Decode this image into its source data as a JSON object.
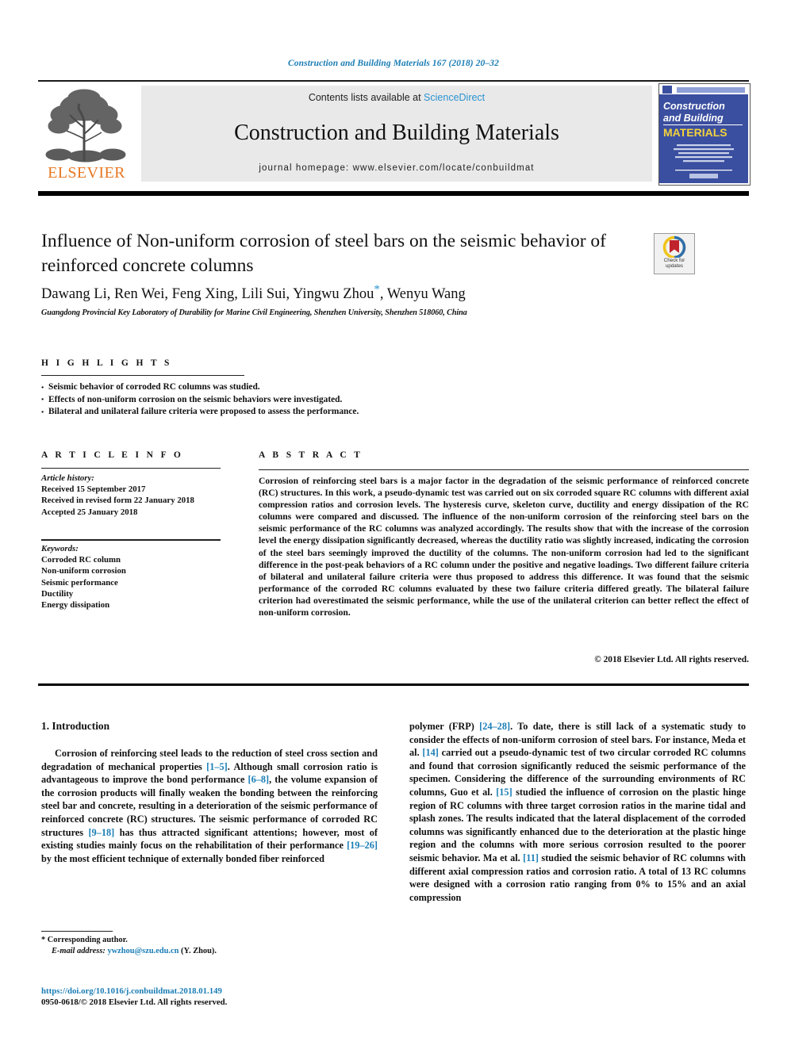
{
  "running_head": "Construction and Building Materials 167 (2018) 20–32",
  "banner": {
    "publisher_name": "ELSEVIER",
    "contents_prefix": "Contents lists available at ",
    "contents_link": "ScienceDirect",
    "journal_title": "Construction and Building Materials",
    "homepage_line": "journal homepage: www.elsevier.com/locate/conbuildmat",
    "cover": {
      "line1": "Construction",
      "line2": "and Building",
      "line3": "MATERIALS"
    },
    "link_color": "#2b93d0",
    "brand_color": "#e87722"
  },
  "article": {
    "title": "Influence of Non-uniform corrosion of steel bars on the seismic behavior of reinforced concrete columns",
    "authors": "Dawang Li, Ren Wei, Feng Xing, Lili Sui, Yingwu Zhou",
    "authors_tail": ", Wenyu Wang",
    "corresponding_marker": "*",
    "affiliation": "Guangdong Provincial Key Laboratory of Durability for Marine Civil Engineering, Shenzhen University, Shenzhen 518060, China",
    "crossmark": {
      "line1": "Check for",
      "line2": "updates"
    }
  },
  "highlights": {
    "label": "H I G H L I G H T S",
    "items": [
      "Seismic behavior of corroded RC columns was studied.",
      "Effects of non-uniform corrosion on the seismic behaviors were investigated.",
      "Bilateral and unilateral failure criteria were proposed to assess the performance."
    ]
  },
  "article_info": {
    "label": "A R T I C L E   I N F O",
    "history_heading": "Article history:",
    "history": [
      "Received 15 September 2017",
      "Received in revised form 22 January 2018",
      "Accepted 25 January 2018"
    ],
    "keywords_heading": "Keywords:",
    "keywords": [
      "Corroded RC column",
      "Non-uniform corrosion",
      "Seismic performance",
      "Ductility",
      "Energy dissipation"
    ]
  },
  "abstract": {
    "label": "A B S T R A C T",
    "text": "Corrosion of reinforcing steel bars is a major factor in the degradation of the seismic performance of reinforced concrete (RC) structures. In this work, a pseudo-dynamic test was carried out on six corroded square RC columns with different axial compression ratios and corrosion levels. The hysteresis curve, skeleton curve, ductility and energy dissipation of the RC columns were compared and discussed. The influence of the non-uniform corrosion of the reinforcing steel bars on the seismic performance of the RC columns was analyzed accordingly. The results show that with the increase of the corrosion level the energy dissipation significantly decreased, whereas the ductility ratio was slightly increased, indicating the corrosion of the steel bars seemingly improved the ductility of the columns. The non-uniform corrosion had led to the significant difference in the post-peak behaviors of a RC column under the positive and negative loadings. Two different failure criteria of bilateral and unilateral failure criteria were thus proposed to address this difference. It was found that the seismic performance of the corroded RC columns evaluated by these two failure criteria differed greatly. The bilateral failure criterion had overestimated the seismic performance, while the use of the unilateral criterion can better reflect the effect of non-uniform corrosion.",
    "copyright": "© 2018 Elsevier Ltd. All rights reserved."
  },
  "body": {
    "section_heading": "1. Introduction",
    "left_para_1_a": "Corrosion of reinforcing steel leads to the reduction of steel cross section and degradation of mechanical properties ",
    "left_ref_1": "[1–5]",
    "left_para_1_b": ". Although small corrosion ratio is advantageous to improve the bond performance ",
    "left_ref_2": "[6–8]",
    "left_para_1_c": ", the volume expansion of the corrosion products will finally weaken the bonding between the reinforcing steel bar and concrete, resulting in a deterioration of the seismic performance of reinforced concrete (RC) structures. The seismic performance of corroded RC structures ",
    "left_ref_3": "[9–18]",
    "left_para_1_d": " has thus attracted significant attentions; however, most of existing studies mainly focus on the rehabilitation of their performance ",
    "left_ref_4": "[19–26]",
    "left_para_1_e": " by the most efficient technique of externally bonded fiber reinforced",
    "right_para_a": "polymer (FRP) ",
    "right_ref_1": "[24–28]",
    "right_para_b": ". To date, there is still lack of a systematic study to consider the effects of non-uniform corrosion of steel bars. For instance, Meda et al. ",
    "right_ref_2": "[14]",
    "right_para_c": " carried out a pseudo-dynamic test of two circular corroded RC columns and found that corrosion significantly reduced the seismic performance of the specimen. Considering the difference of the surrounding environments of RC columns, Guo et al. ",
    "right_ref_3": "[15]",
    "right_para_d": " studied the influence of corrosion on the plastic hinge region of RC columns with three target corrosion ratios in the marine tidal and splash zones. The results indicated that the lateral displacement of the corroded columns was significantly enhanced due to the deterioration at the plastic hinge region and the columns with more serious corrosion resulted to the poorer seismic behavior. Ma et al. ",
    "right_ref_4": "[11]",
    "right_para_e": " studied the seismic behavior of RC columns with different axial compression ratios and corrosion ratio. A total of 13 RC columns were designed with a corrosion ratio ranging from 0% to 15% and an axial compression"
  },
  "footer": {
    "corresponding_marker": "*",
    "corresponding_label": " Corresponding author.",
    "email_label": "E-mail address:",
    "email": "ywzhou@szu.edu.cn",
    "email_suffix": "(Y. Zhou).",
    "doi": "https://doi.org/10.1016/j.conbuildmat.2018.01.149",
    "issn_line": "0950-0618/© 2018 Elsevier Ltd. All rights reserved.",
    "link_color": "#1a7db6"
  }
}
